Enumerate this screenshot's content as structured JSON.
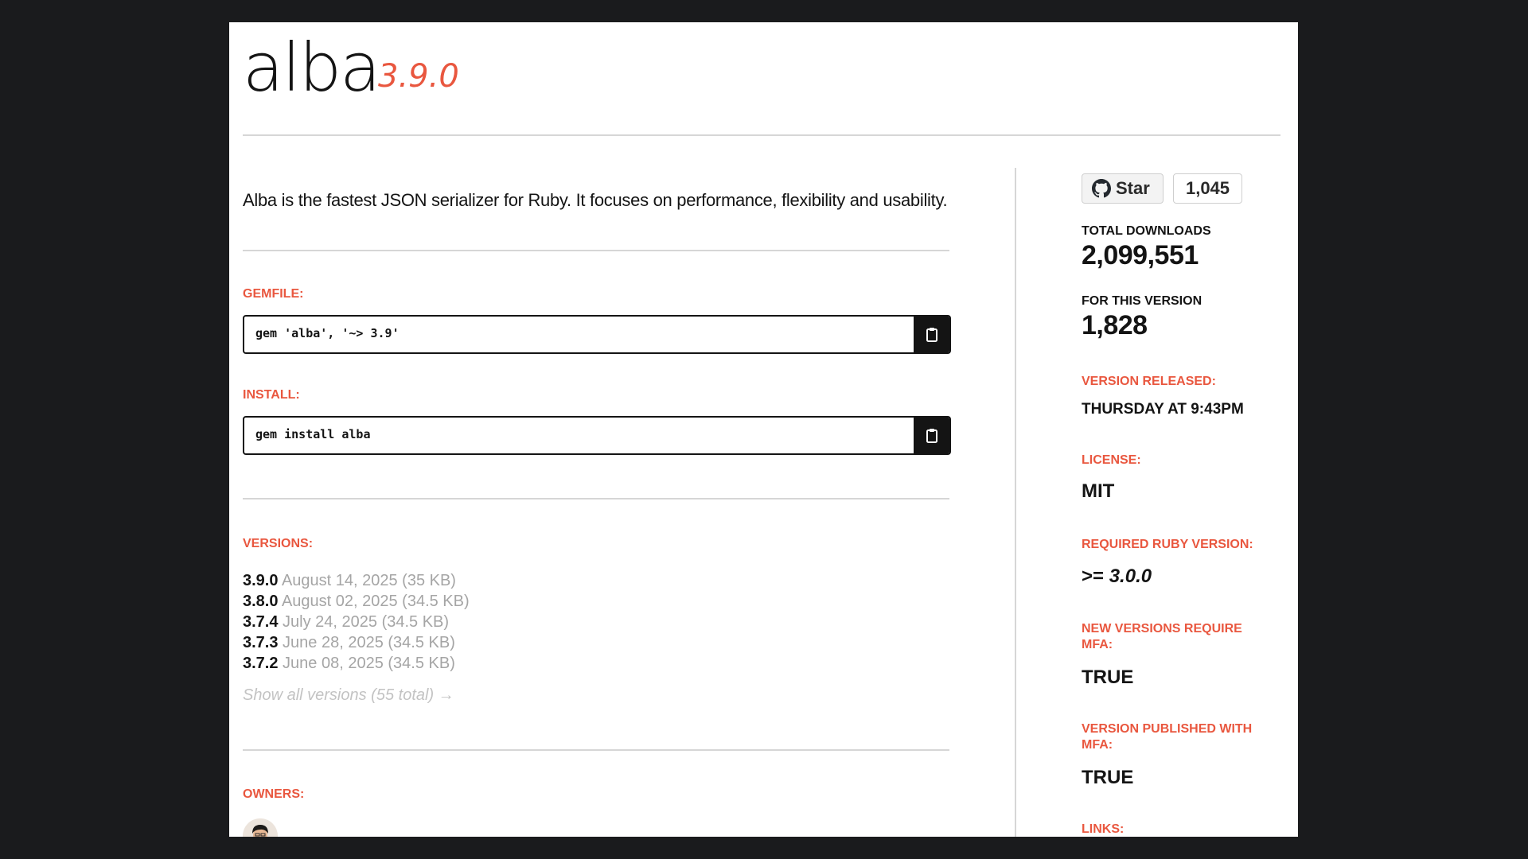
{
  "header": {
    "gem_name": "alba",
    "version": "3.9.0"
  },
  "main": {
    "description": "Alba is the fastest JSON serializer for Ruby. It focuses on performance, flexibility and usability.",
    "gemfile_label": "GEMFILE:",
    "gemfile_code": "gem 'alba', '~> 3.9'",
    "install_label": "INSTALL:",
    "install_code": "gem install alba",
    "versions_label": "VERSIONS:",
    "versions": [
      {
        "number": "3.9.0",
        "meta": "August 14, 2025 (35 KB)"
      },
      {
        "number": "3.8.0",
        "meta": "August 02, 2025 (34.5 KB)"
      },
      {
        "number": "3.7.4",
        "meta": "July 24, 2025 (34.5 KB)"
      },
      {
        "number": "3.7.3",
        "meta": "June 28, 2025 (34.5 KB)"
      },
      {
        "number": "3.7.2",
        "meta": "June 08, 2025 (34.5 KB)"
      }
    ],
    "show_all": "Show all versions (55 total) →",
    "owners_label": "OWNERS:"
  },
  "sidebar": {
    "star_label": "Star",
    "star_count": "1,045",
    "total_downloads_label": "TOTAL DOWNLOADS",
    "total_downloads": "2,099,551",
    "this_version_label": "FOR THIS VERSION",
    "this_version": "1,828",
    "released_label": "VERSION RELEASED:",
    "released": "THURSDAY AT 9:43PM",
    "license_label": "LICENSE:",
    "license": "MIT",
    "ruby_label": "REQUIRED RUBY VERSION:",
    "ruby_prefix": ">=",
    "ruby_version": "3.0.0",
    "mfa_label": "NEW VERSIONS REQUIRE MFA:",
    "mfa": "TRUE",
    "published_mfa_label": "VERSION PUBLISHED WITH MFA:",
    "published_mfa": "TRUE",
    "links_label": "LINKS:"
  },
  "icons": {
    "copy": "clipboard-icon",
    "github": "github-icon"
  },
  "colors": {
    "accent": "#e9573f",
    "background": "#1a1b1d",
    "muted": "#a5a5a5"
  }
}
